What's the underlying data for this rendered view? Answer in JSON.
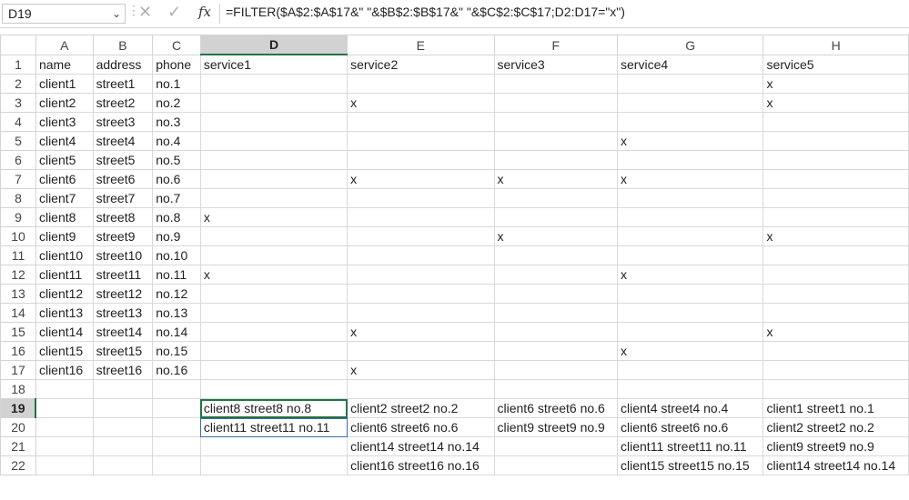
{
  "formula_bar": {
    "name_box": "D19",
    "name_box_arrow": "⌄",
    "cancel_icon": "✕",
    "confirm_icon": "✓",
    "fx_label": "fx",
    "formula": "=FILTER($A$2:$A$17&\" \"&$B$2:$B$17&\" \"&$C$2:$C$17;D2:D17=\"x\")"
  },
  "sheet": {
    "columns": [
      "A",
      "B",
      "C",
      "D",
      "E",
      "F",
      "G",
      "H"
    ],
    "selected_column": "D",
    "selected_row": 19,
    "active_cell": "D19",
    "rows": [
      {
        "n": "1",
        "cells": [
          "name",
          "address",
          "phone",
          "service1",
          "service2",
          "service3",
          "service4",
          "service5"
        ]
      },
      {
        "n": "2",
        "cells": [
          "client1",
          "street1",
          "no.1",
          "",
          "",
          "",
          "",
          "x"
        ]
      },
      {
        "n": "3",
        "cells": [
          "client2",
          "street2",
          "no.2",
          "",
          "x",
          "",
          "",
          "x"
        ]
      },
      {
        "n": "4",
        "cells": [
          "client3",
          "street3",
          "no.3",
          "",
          "",
          "",
          "",
          ""
        ]
      },
      {
        "n": "5",
        "cells": [
          "client4",
          "street4",
          "no.4",
          "",
          "",
          "",
          "x",
          ""
        ]
      },
      {
        "n": "6",
        "cells": [
          "client5",
          "street5",
          "no.5",
          "",
          "",
          "",
          "",
          ""
        ]
      },
      {
        "n": "7",
        "cells": [
          "client6",
          "street6",
          "no.6",
          "",
          "x",
          "x",
          "x",
          ""
        ]
      },
      {
        "n": "8",
        "cells": [
          "client7",
          "street7",
          "no.7",
          "",
          "",
          "",
          "",
          ""
        ]
      },
      {
        "n": "9",
        "cells": [
          "client8",
          "street8",
          "no.8",
          "x",
          "",
          "",
          "",
          ""
        ]
      },
      {
        "n": "10",
        "cells": [
          "client9",
          "street9",
          "no.9",
          "",
          "",
          "x",
          "",
          "x"
        ]
      },
      {
        "n": "11",
        "cells": [
          "client10",
          "street10",
          "no.10",
          "",
          "",
          "",
          "",
          ""
        ]
      },
      {
        "n": "12",
        "cells": [
          "client11",
          "street11",
          "no.11",
          "x",
          "",
          "",
          "x",
          ""
        ]
      },
      {
        "n": "13",
        "cells": [
          "client12",
          "street12",
          "no.12",
          "",
          "",
          "",
          "",
          ""
        ]
      },
      {
        "n": "14",
        "cells": [
          "client13",
          "street13",
          "no.13",
          "",
          "",
          "",
          "",
          ""
        ]
      },
      {
        "n": "15",
        "cells": [
          "client14",
          "street14",
          "no.14",
          "",
          "x",
          "",
          "",
          "x"
        ]
      },
      {
        "n": "16",
        "cells": [
          "client15",
          "street15",
          "no.15",
          "",
          "",
          "",
          "x",
          ""
        ]
      },
      {
        "n": "17",
        "cells": [
          "client16",
          "street16",
          "no.16",
          "",
          "x",
          "",
          "",
          ""
        ]
      },
      {
        "n": "18",
        "cells": [
          "",
          "",
          "",
          "",
          "",
          "",
          "",
          ""
        ]
      },
      {
        "n": "19",
        "cells": [
          "",
          "",
          "",
          "client8 street8 no.8",
          "client2 street2 no.2",
          "client6 street6 no.6",
          "client4 street4 no.4",
          "client1 street1 no.1"
        ]
      },
      {
        "n": "20",
        "cells": [
          "",
          "",
          "",
          "client11 street11 no.11",
          "client6 street6 no.6",
          "client9 street9 no.9",
          "client6 street6 no.6",
          "client2 street2 no.2"
        ]
      },
      {
        "n": "21",
        "cells": [
          "",
          "",
          "",
          "",
          "client14 street14 no.14",
          "",
          "client11 street11 no.11",
          "client9 street9 no.9"
        ]
      },
      {
        "n": "22",
        "cells": [
          "",
          "",
          "",
          "",
          "client16 street16 no.16",
          "",
          "client15 street15 no.15",
          "client14 street14 no.14"
        ]
      }
    ]
  },
  "colors": {
    "selection_green": "#217346",
    "header_selected_bg": "#d2d2d2",
    "gridline": "#d9d9d9"
  }
}
